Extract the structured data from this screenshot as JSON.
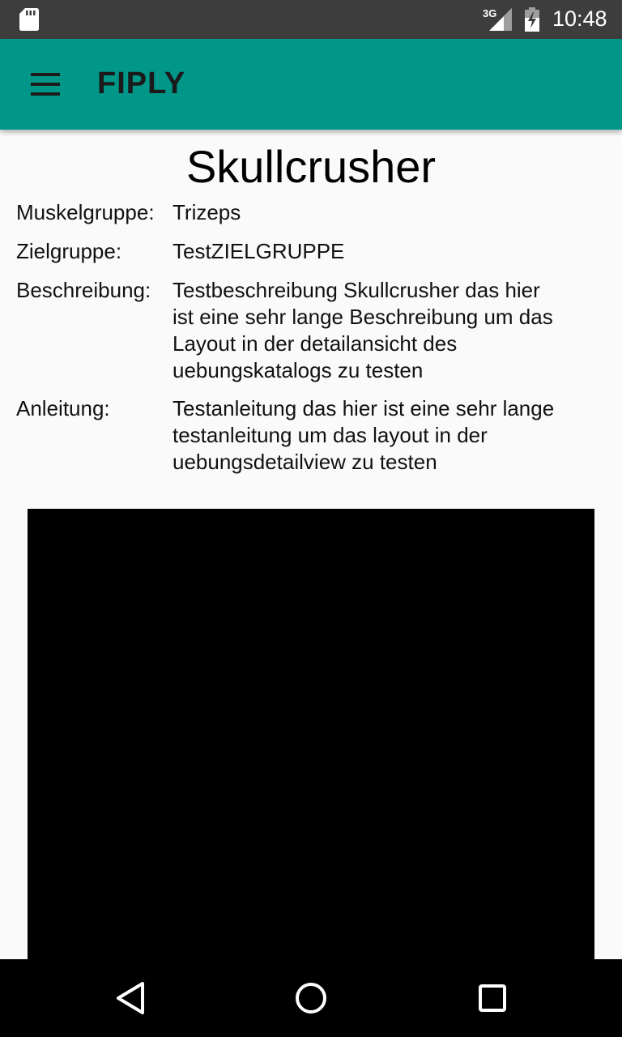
{
  "status_bar": {
    "network_type": "3G",
    "time": "10:48",
    "icons": [
      "sd-card-icon",
      "signal-icon",
      "battery-icon"
    ]
  },
  "app_bar": {
    "title": "FIPLY",
    "menu_icon": "hamburger-menu-icon",
    "color": "#009688"
  },
  "exercise": {
    "title": "Skullcrusher",
    "fields": {
      "muskelgruppe": {
        "label": "Muskelgruppe:",
        "value": "Trizeps"
      },
      "zielgruppe": {
        "label": "Zielgruppe:",
        "value": "TestZIELGRUPPE"
      },
      "beschreibung": {
        "label": "Beschreibung:",
        "value": "Testbeschreibung Skullcrusher das hier ist eine sehr lange Beschreibung um das Layout in der detailansicht des uebungskatalogs zu testen"
      },
      "anleitung": {
        "label": "Anleitung:",
        "value": "Testanleitung das hier ist eine sehr lange testanleitung um das layout in der uebungsdetailview zu testen"
      }
    }
  },
  "navigation_bar": {
    "buttons": [
      "back-icon",
      "home-icon",
      "recents-icon"
    ]
  }
}
